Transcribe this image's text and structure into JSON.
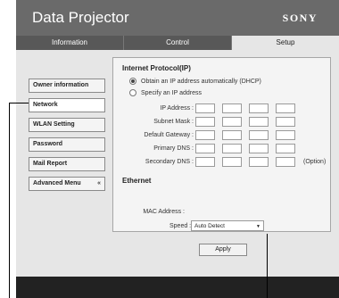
{
  "app": {
    "title": "Data Projector",
    "brand": "SONY"
  },
  "tabs": [
    {
      "label": "Information",
      "active": false
    },
    {
      "label": "Control",
      "active": false
    },
    {
      "label": "Setup",
      "active": true
    }
  ],
  "sidebar": {
    "items": [
      {
        "label": "Owner information",
        "active": false
      },
      {
        "label": "Network",
        "active": true
      },
      {
        "label": "WLAN Setting",
        "active": false
      },
      {
        "label": "Password",
        "active": false
      },
      {
        "label": "Mail Report",
        "active": false
      },
      {
        "label": "Advanced Menu",
        "active": false,
        "icon": "chevron-double-down-icon"
      }
    ]
  },
  "ip_section": {
    "title": "Internet Protocol(IP)",
    "options": [
      {
        "label": "Obtain an IP address automatically (DHCP)",
        "checked": true
      },
      {
        "label": "Specify an IP address",
        "checked": false
      }
    ],
    "fields": [
      {
        "label": "IP Address :",
        "values": [
          "",
          "",
          "",
          ""
        ]
      },
      {
        "label": "Subnet Mask :",
        "values": [
          "",
          "",
          "",
          ""
        ]
      },
      {
        "label": "Default Gateway :",
        "values": [
          "",
          "",
          "",
          ""
        ]
      },
      {
        "label": "Primary DNS :",
        "values": [
          "",
          "",
          "",
          ""
        ]
      },
      {
        "label": "Secondary DNS :",
        "values": [
          "",
          "",
          "",
          ""
        ],
        "note": "(Option)"
      }
    ]
  },
  "ethernet": {
    "title": "Ethernet",
    "mac_label": "MAC Address :",
    "speed_label": "Speed :",
    "speed_value": "Auto Detect"
  },
  "apply_label": "Apply",
  "colors": {
    "header": "#6a6a6a",
    "content": "#e6e6e6",
    "footer": "#222222"
  }
}
